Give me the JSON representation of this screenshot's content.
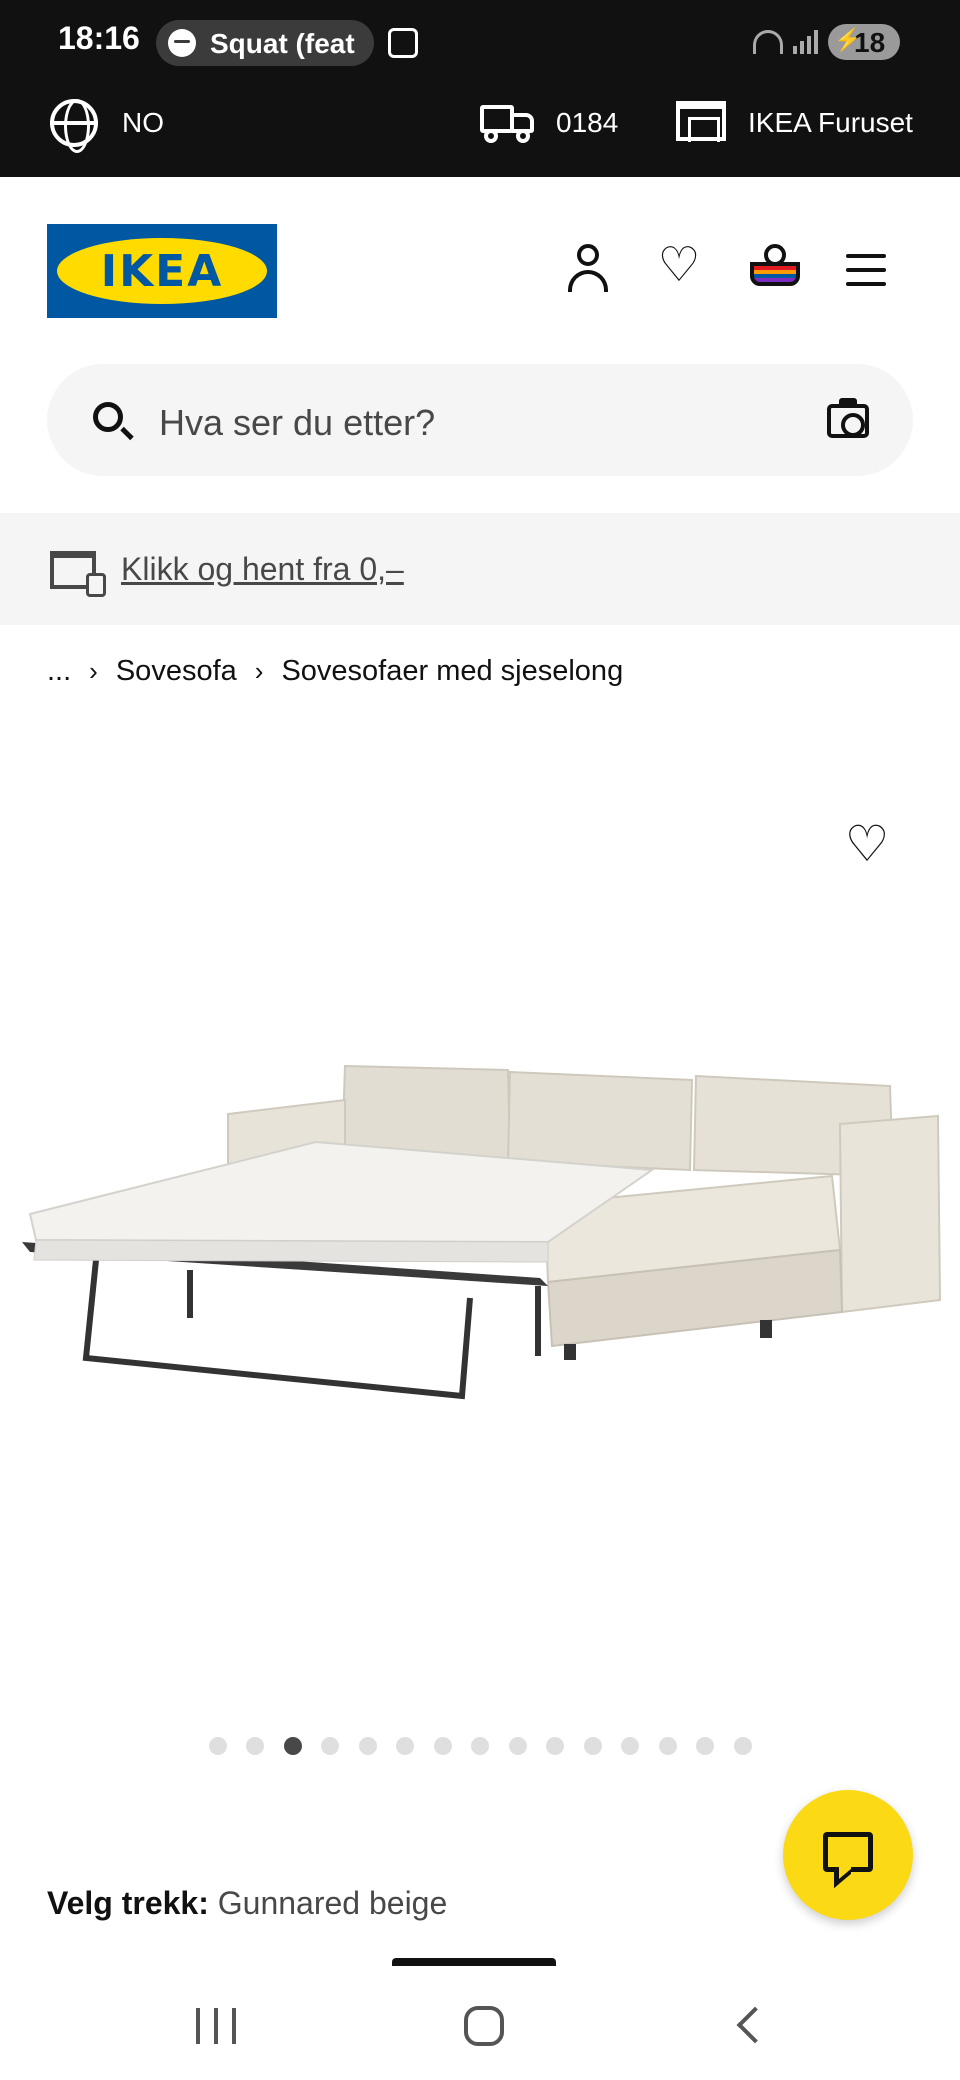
{
  "status_bar": {
    "time": "18:16",
    "now_playing": "Squat (feat",
    "battery": "18"
  },
  "top_strip": {
    "language": "NO",
    "postal_code": "0184",
    "store": "IKEA Furuset"
  },
  "header": {
    "logo_text": "IKEA",
    "brand_colors": {
      "blue": "#0058a3",
      "yellow": "#ffdb00"
    }
  },
  "search": {
    "placeholder": "Hva ser du etter?"
  },
  "promo": {
    "text": "Klikk og hent fra 0,–"
  },
  "breadcrumb": {
    "items": [
      "...",
      "Sovesofa",
      "Sovesofaer med sjeselong"
    ]
  },
  "gallery": {
    "total_images": 15,
    "active_index": 3
  },
  "cover": {
    "label": "Velg trekk:",
    "value": "Gunnared beige"
  },
  "icons": {
    "globe": "globe-icon",
    "delivery": "truck-icon",
    "store": "store-icon",
    "account": "person-icon",
    "favourites": "heart-icon",
    "basket": "basket-icon",
    "menu": "hamburger-menu-icon",
    "search": "search-icon",
    "camera": "camera-icon",
    "chat": "chat-icon"
  }
}
